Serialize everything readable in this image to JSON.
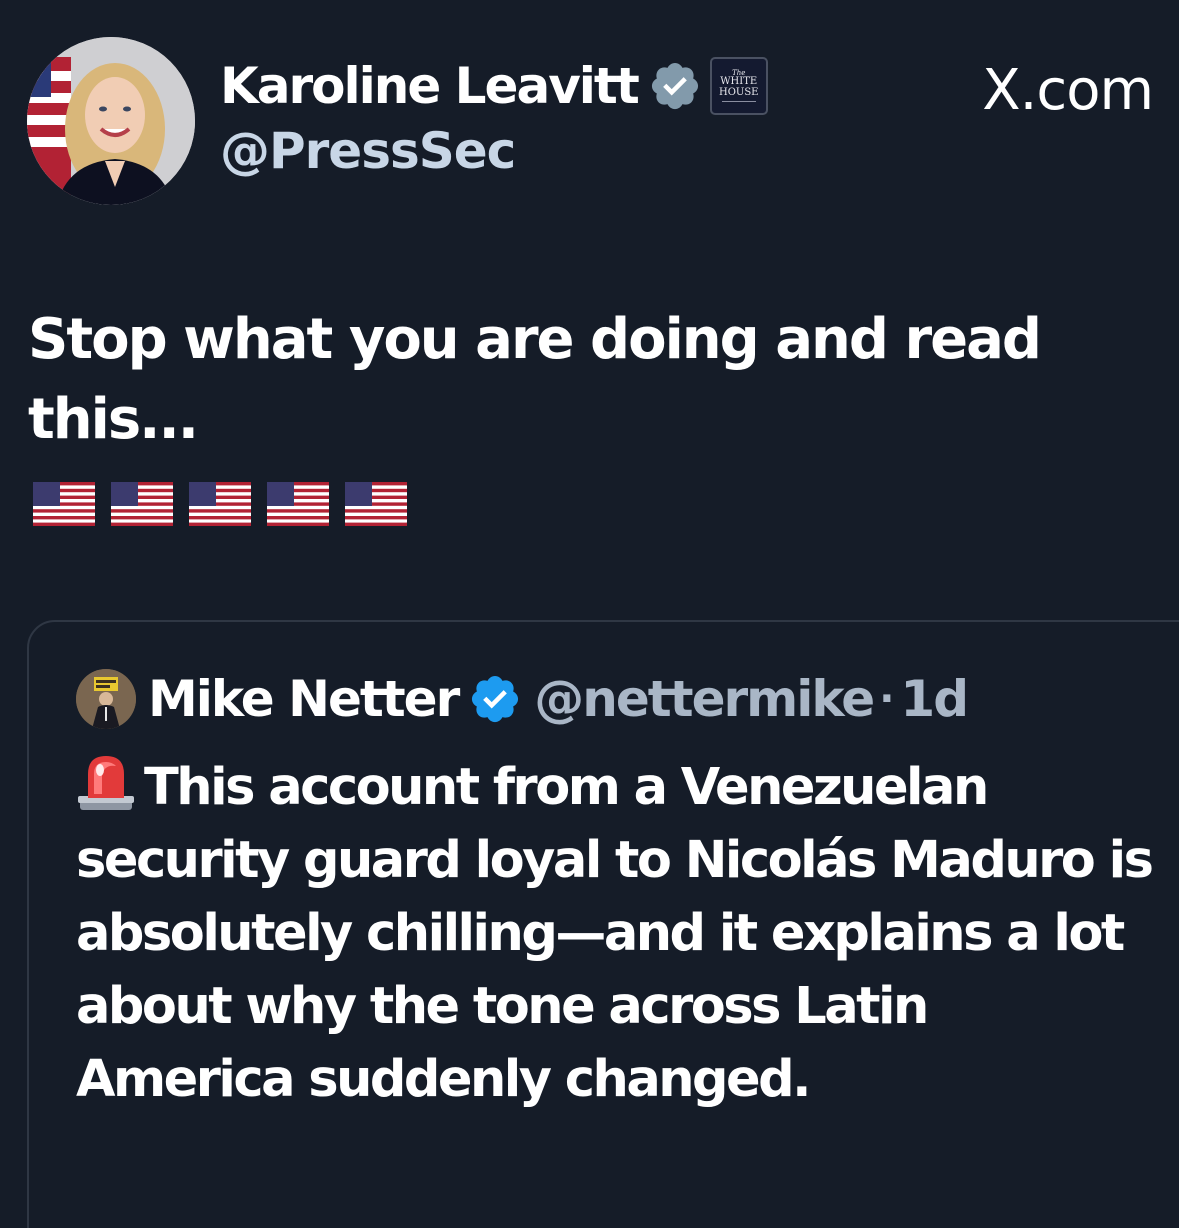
{
  "brand": {
    "label": "X.com",
    "logo_icon": "x-logo-icon"
  },
  "main_post": {
    "author": {
      "name": "Karoline Leavitt",
      "handle": "@PressSec",
      "verified_badge": "verified-gray-icon",
      "affiliation_badge": {
        "icon": "white-house-badge-icon",
        "text_small": "The",
        "text_line1": "WHITE",
        "text_line2": "HOUSE"
      }
    },
    "text": "Stop what you are doing and read this...",
    "emoji": [
      "us-flag-icon",
      "us-flag-icon",
      "us-flag-icon",
      "us-flag-icon",
      "us-flag-icon"
    ]
  },
  "quoted_post": {
    "author": {
      "name": "Mike Netter",
      "handle": "@nettermike",
      "separator": "·",
      "time": "1d",
      "verified_badge": "verified-blue-icon"
    },
    "leading_emoji": "siren-icon",
    "text": "This account from a Venezuelan security guard loyal to Nicolás Maduro is absolutely chilling—and it explains a lot about why the tone across Latin America suddenly changed."
  },
  "colors": {
    "background": "#151c28",
    "primary_text": "#ffffff",
    "handle_text": "#c8d6e6",
    "secondary_text": "#a9b6c6",
    "verified_blue": "#1d9bf0",
    "verified_gray": "#829aab",
    "card_border": "#2f3744"
  }
}
